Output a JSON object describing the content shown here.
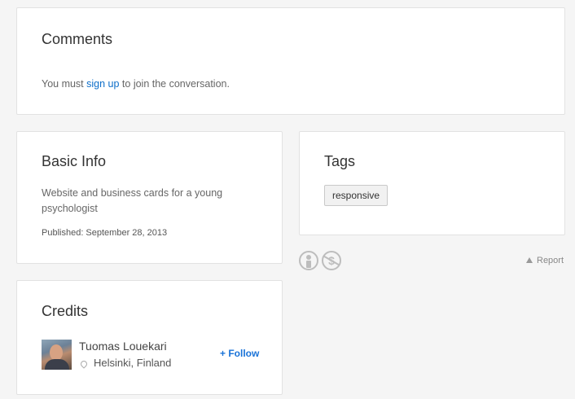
{
  "comments": {
    "title": "Comments",
    "msg_before": "You must ",
    "signup_link": "sign up",
    "msg_after": " to join the conversation."
  },
  "basic_info": {
    "title": "Basic Info",
    "description": "Website and business cards for a young psychologist",
    "published": "Published: September 28, 2013"
  },
  "tags": {
    "title": "Tags",
    "items": [
      "responsive"
    ]
  },
  "license": {
    "icons": [
      "attribution-icon",
      "noncommercial-icon"
    ]
  },
  "report": {
    "label": "Report"
  },
  "credits": {
    "title": "Credits",
    "user": {
      "name": "Tuomas Louekari",
      "location": "Helsinki, Finland",
      "follow_label": "+ Follow"
    }
  }
}
